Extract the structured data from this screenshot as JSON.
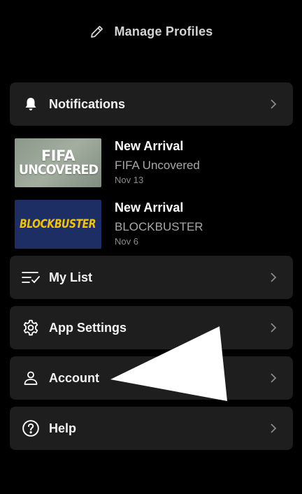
{
  "header": {
    "manage_profiles_label": "Manage Profiles",
    "icon": "pencil-icon"
  },
  "notifications_row": {
    "label": "Notifications",
    "icon": "bell-icon"
  },
  "notifications": [
    {
      "type": "New Arrival",
      "title": "FIFA Uncovered",
      "date": "Nov 13",
      "thumbnail_text": [
        "FIFA",
        "UNCOVERED"
      ]
    },
    {
      "type": "New Arrival",
      "title": "BLOCKBUSTER",
      "date": "Nov 6",
      "thumbnail_text": [
        "BLOCKBUSTER"
      ]
    }
  ],
  "menu": [
    {
      "label": "My List",
      "icon": "list-check-icon"
    },
    {
      "label": "App Settings",
      "icon": "gear-icon"
    },
    {
      "label": "Account",
      "icon": "person-icon"
    },
    {
      "label": "Help",
      "icon": "help-circle-icon"
    }
  ],
  "colors": {
    "background": "#000000",
    "row_background": "#1e1e1e",
    "text_primary": "#ffffff",
    "text_secondary": "#a8a8a8",
    "blockbuster_yellow": "#f5c400",
    "blockbuster_blue": "#1c2e63"
  }
}
